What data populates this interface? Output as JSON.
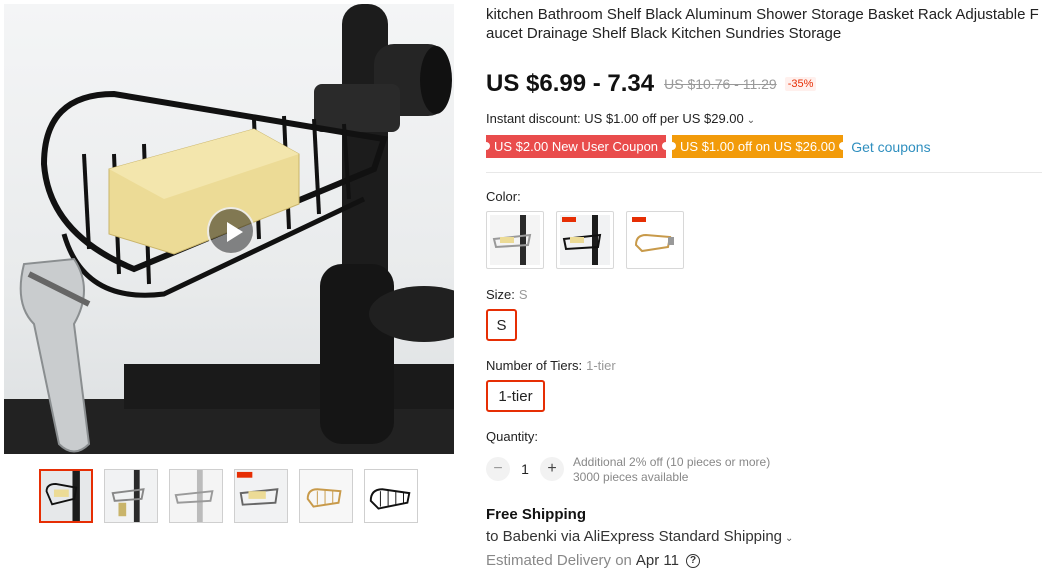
{
  "product": {
    "title": "kitchen Bathroom Shelf Black Aluminum Shower Storage Basket Rack Adjustable Faucet Drainage Shelf Black Kitchen Sundries Storage",
    "price": "US $6.99 - 7.34",
    "original_price": "US $10.76 - 11.29",
    "discount_badge": "-35%"
  },
  "promo": {
    "instant_discount": "Instant discount: US $1.00 off per US $29.00",
    "coupons": [
      {
        "label": "US $2.00 New User Coupon",
        "color": "#e94c4c"
      },
      {
        "label": "US $1.00 off on US $26.00",
        "color": "#f29b0a"
      }
    ],
    "get_coupons": "Get coupons"
  },
  "color": {
    "label": "Color:",
    "options": [
      {
        "icon": "silver-rack-on-faucet-thumbnail"
      },
      {
        "icon": "black-rack-on-faucet-thumbnail"
      },
      {
        "icon": "gold-rack-thumbnail"
      }
    ]
  },
  "size": {
    "label": "Size:",
    "selected": "S",
    "options": [
      "S"
    ]
  },
  "tiers": {
    "label": "Number of Tiers:",
    "selected": "1-tier",
    "options": [
      "1-tier"
    ]
  },
  "quantity": {
    "label": "Quantity:",
    "value": "1",
    "decrement": "−",
    "increment": "+",
    "note_line1": "Additional 2% off (10 pieces or more)",
    "note_line2": "3000 pieces available"
  },
  "shipping": {
    "title": "Free Shipping",
    "line": "to Babenki via AliExpress Standard Shipping",
    "delivery_label": "Estimated Delivery on",
    "delivery_date": "Apr 11"
  },
  "gallery": {
    "main_icon": "black-faucet-sponge-rack-photo",
    "play_icon": "play-icon",
    "thumbnails": [
      {
        "icon": "black-rack-thumbnail",
        "active": true
      },
      {
        "icon": "silver-rack-with-bottle-thumbnail",
        "active": false
      },
      {
        "icon": "silver-rack-on-faucet-thumbnail",
        "active": false
      },
      {
        "icon": "rack-with-sponge-badge-thumbnail",
        "active": false
      },
      {
        "icon": "gold-rack-thumbnail",
        "active": false
      },
      {
        "icon": "black-rack-outline-thumbnail",
        "active": false
      }
    ]
  },
  "colors": {
    "accent": "#e62e04",
    "link": "#2f8fbf"
  }
}
